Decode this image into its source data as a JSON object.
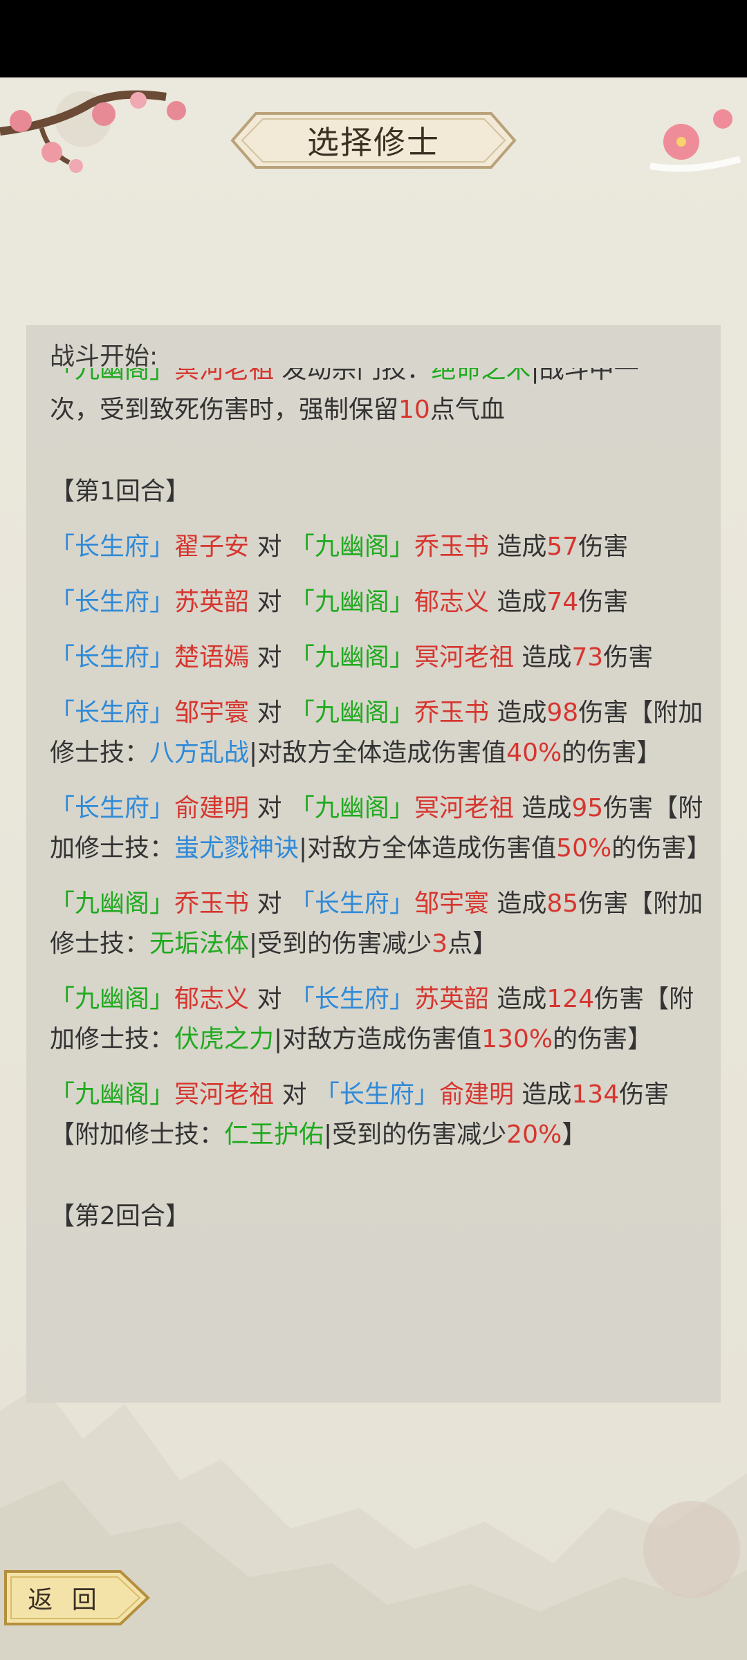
{
  "title": "选择修士",
  "back_label": "返 回",
  "log": {
    "header": "战斗开始:",
    "intro_clipped": {
      "faction": "「九幽阁」",
      "name": "冥河老祖",
      "action": " 发动宗门技：",
      "skill": "绝命之术",
      "rest": "|战斗中一"
    },
    "intro_line2_a": "次，受到致死伤害时，强制保留",
    "intro_val": "10",
    "intro_line2_b": "点气血",
    "round1": "【第1回合】",
    "round2": "【第2回合】",
    "entries": [
      {
        "af": "「长生府」",
        "an": "翟子安",
        "vs": " 对 ",
        "df": "「九幽阁」",
        "dn": "乔玉书",
        "t1": " 造成",
        "dmg": "57",
        "t2": "伤害"
      },
      {
        "af": "「长生府」",
        "an": "苏英韶",
        "vs": " 对 ",
        "df": "「九幽阁」",
        "dn": "郁志义",
        "t1": " 造成",
        "dmg": "74",
        "t2": "伤害"
      },
      {
        "af": "「长生府」",
        "an": "楚语嫣",
        "vs": " 对 ",
        "df": "「九幽阁」",
        "dn": "冥河老祖",
        "t1": " 造成",
        "dmg": "73",
        "t2": "伤害"
      },
      {
        "af": "「长生府」",
        "an": "邹宇寰",
        "vs": " 对 ",
        "df": "「九幽阁」",
        "dn": "乔玉书",
        "t1": " 造成",
        "dmg": "98",
        "t2": "伤害【附加修士技：",
        "skill": "八方乱战",
        "desc": "|对敌方全体造成伤害值",
        "pct": "40%",
        "end": "的伤害】"
      },
      {
        "af": "「长生府」",
        "an": "俞建明",
        "vs": " 对 ",
        "df": "「九幽阁」",
        "dn": "冥河老祖",
        "t1": " 造成",
        "dmg": "95",
        "t2": "伤害【附加修士技：",
        "skill": "蚩尤戮神诀",
        "desc": "|对敌方全体造成伤害值",
        "pct": "50%",
        "end": "的伤害】"
      },
      {
        "af": "「九幽阁」",
        "an": "乔玉书",
        "vs": " 对 ",
        "df": "「长生府」",
        "dn": "邹宇寰",
        "t1": " 造成",
        "dmg": "85",
        "t2": "伤害【附加修士技：",
        "skill": "无垢法体",
        "desc": "|受到的伤害减少",
        "pct": "3",
        "end": "点】"
      },
      {
        "af": "「九幽阁」",
        "an": "郁志义",
        "vs": " 对 ",
        "df": "「长生府」",
        "dn": "苏英韶",
        "t1": " 造成",
        "dmg": "124",
        "t2": "伤害【附加修士技：",
        "skill": "伏虎之力",
        "desc": "|对敌方造成伤害值",
        "pct": "130%",
        "end": "的伤害】"
      },
      {
        "af": "「九幽阁」",
        "an": "冥河老祖",
        "vs": " 对 ",
        "df": "「长生府」",
        "dn": "俞建明",
        "t1": " 造成",
        "dmg": "134",
        "t2": "伤害【附加修士技：",
        "skill": "仁王护佑",
        "desc": "|受到的伤害减少",
        "pct": "20%",
        "end": "】"
      }
    ]
  },
  "colors": {
    "changsheng": "#2f8ad8",
    "jiuyou": "#1faa1f",
    "name_red": "#d6362f",
    "skill_blue": "#2f8ad8",
    "skill_green": "#1faa1f"
  }
}
